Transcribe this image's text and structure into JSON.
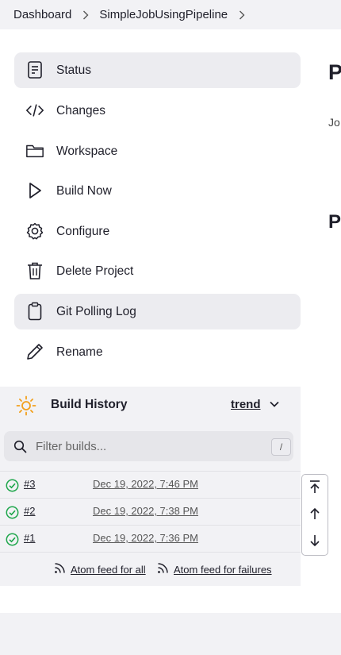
{
  "breadcrumb": {
    "items": [
      "Dashboard",
      "SimpleJobUsingPipeline"
    ]
  },
  "tasks": [
    {
      "label": "Status",
      "icon": "status-icon",
      "active": true
    },
    {
      "label": "Changes",
      "icon": "code-icon",
      "active": false
    },
    {
      "label": "Workspace",
      "icon": "folder-icon",
      "active": false
    },
    {
      "label": "Build Now",
      "icon": "play-icon",
      "active": false
    },
    {
      "label": "Configure",
      "icon": "gear-icon",
      "active": false
    },
    {
      "label": "Delete Project",
      "icon": "trash-icon",
      "active": false
    },
    {
      "label": "Git Polling Log",
      "icon": "clipboard-icon",
      "active": true
    },
    {
      "label": "Rename",
      "icon": "pencil-icon",
      "active": false
    }
  ],
  "build_history": {
    "title": "Build History",
    "trend_label": "trend",
    "filter_placeholder": "Filter builds...",
    "filter_shortcut": "/",
    "builds": [
      {
        "number": "#3",
        "date": "Dec 19, 2022, 7:46 PM",
        "status": "success"
      },
      {
        "number": "#2",
        "date": "Dec 19, 2022, 7:38 PM",
        "status": "success"
      },
      {
        "number": "#1",
        "date": "Dec 19, 2022, 7:36 PM",
        "status": "success"
      }
    ],
    "feeds": {
      "all": "Atom feed for all",
      "failures": "Atom feed for failures"
    }
  },
  "main": {
    "title_partial": "P",
    "desc_partial": "Jo",
    "section_partial": "P"
  },
  "colors": {
    "success": "#1ea64b",
    "sun": "#f2a01d",
    "panel_bg": "#f2f2f5",
    "active_bg": "#ececf0"
  }
}
